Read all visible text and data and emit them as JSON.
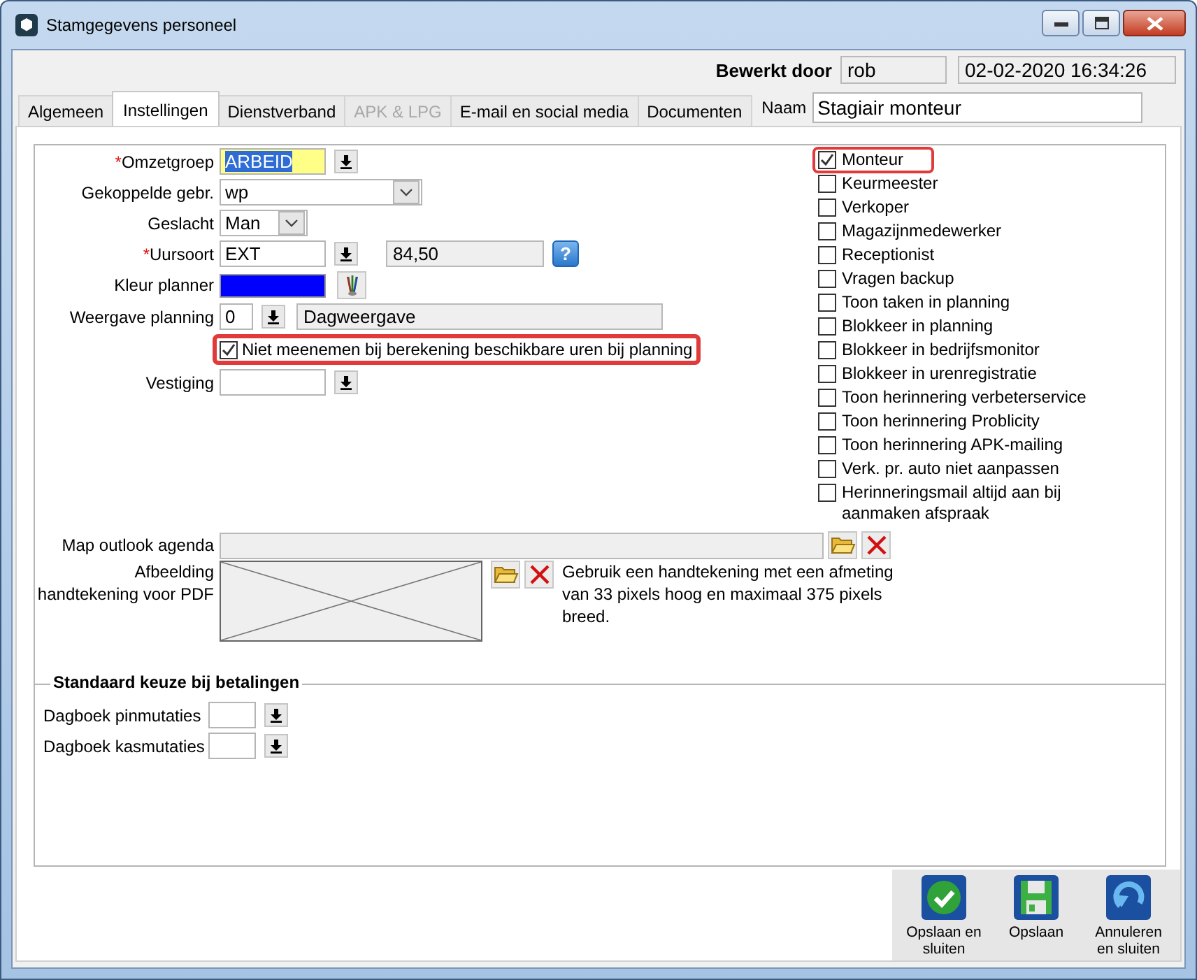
{
  "window": {
    "title": "Stamgegevens personeel"
  },
  "header": {
    "edited_by_label": "Bewerkt door",
    "edited_by": "rob",
    "timestamp": "02-02-2020 16:34:26"
  },
  "tabs": [
    {
      "label": "Algemeen",
      "selected": false,
      "disabled": false
    },
    {
      "label": "Instellingen",
      "selected": true,
      "disabled": false
    },
    {
      "label": "Dienstverband",
      "selected": false,
      "disabled": false
    },
    {
      "label": "APK & LPG",
      "selected": false,
      "disabled": true
    },
    {
      "label": "E-mail en social media",
      "selected": false,
      "disabled": false
    },
    {
      "label": "Documenten",
      "selected": false,
      "disabled": false
    }
  ],
  "name_field": {
    "label": "Naam",
    "value": "Stagiair monteur"
  },
  "required_mark": "*",
  "fields": [
    {
      "kind": "lookup",
      "label": "Omzetgroep",
      "required": true,
      "focused": true,
      "value": "ARBEID"
    },
    {
      "kind": "dropdown",
      "label": "Gekoppelde gebr.",
      "required": false,
      "value": "wp"
    },
    {
      "kind": "dropdown",
      "label": "Geslacht",
      "required": false,
      "value": "Man"
    },
    {
      "kind": "lookup",
      "label": "Uursoort",
      "required": true,
      "focused": false,
      "value": "EXT",
      "extra": "84,50",
      "help": "?"
    },
    {
      "kind": "color",
      "label": "Kleur planner",
      "required": false,
      "color": "#0000ff"
    },
    {
      "kind": "lookup",
      "label": "Weergave planning",
      "required": false,
      "focused": false,
      "value": "0",
      "description": "Dagweergave"
    },
    {
      "kind": "checkbox",
      "label": "Niet meenemen bij berekening beschikbare uren bij planning",
      "checked": true,
      "highlighted": true
    },
    {
      "kind": "lookup",
      "label": "Vestiging",
      "required": false,
      "focused": false
    }
  ],
  "roles": [
    {
      "label": "Monteur",
      "checked": true,
      "highlighted": true
    },
    {
      "label": "Keurmeester",
      "checked": false,
      "highlighted": false
    },
    {
      "label": "Verkoper",
      "checked": false,
      "highlighted": false
    },
    {
      "label": "Magazijnmedewerker",
      "checked": false,
      "highlighted": false
    },
    {
      "label": "Receptionist",
      "checked": false,
      "highlighted": false
    },
    {
      "label": "Vragen backup",
      "checked": false,
      "highlighted": false
    },
    {
      "label": "Toon taken in planning",
      "checked": false,
      "highlighted": false
    },
    {
      "label": "Blokkeer in planning",
      "checked": false,
      "highlighted": false
    },
    {
      "label": "Blokkeer in bedrijfsmonitor",
      "checked": false,
      "highlighted": false
    },
    {
      "label": "Blokkeer in urenregistratie",
      "checked": false,
      "highlighted": false
    },
    {
      "label": "Toon herinnering verbeterservice",
      "checked": false,
      "highlighted": false
    },
    {
      "label": "Toon herinnering Problicity",
      "checked": false,
      "highlighted": false
    },
    {
      "label": "Toon herinnering APK-mailing",
      "checked": false,
      "highlighted": false
    },
    {
      "label": "Verk. pr. auto niet aanpassen",
      "checked": false,
      "highlighted": false
    },
    {
      "label": "Herinneringsmail altijd aan bij aanmaken afspraak",
      "checked": false,
      "highlighted": false
    }
  ],
  "outlook": {
    "label": "Map outlook agenda"
  },
  "signature": {
    "label": "Afbeelding handtekening voor PDF",
    "hint": "Gebruik een handtekening met een afmeting van 33 pixels hoog en maximaal 375 pixels breed."
  },
  "payments": {
    "title": "Standaard keuze bij betalingen",
    "fields": [
      {
        "label": "Dagboek pinmutaties"
      },
      {
        "label": "Dagboek kasmutaties"
      }
    ]
  },
  "buttons": [
    {
      "kind": "save_close",
      "label": "Opslaan en sluiten"
    },
    {
      "kind": "save",
      "label": "Opslaan"
    },
    {
      "kind": "cancel",
      "label": "Annuleren en sluiten"
    }
  ]
}
